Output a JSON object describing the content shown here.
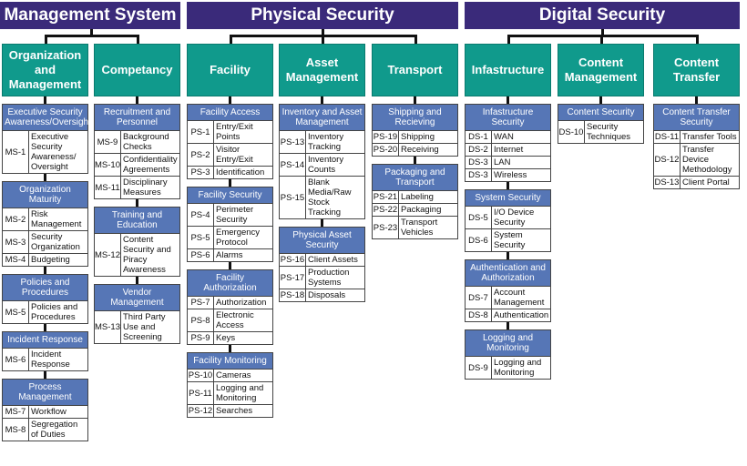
{
  "sections": [
    {
      "title": "Management System",
      "columns": [
        0,
        1
      ]
    },
    {
      "title": "Physical Security",
      "columns": [
        2,
        3,
        4
      ]
    },
    {
      "title": "Digital Security",
      "columns": [
        5,
        6,
        7
      ]
    }
  ],
  "columns": [
    {
      "title": "Organization and Management",
      "groups": [
        {
          "title": "Executive Security Awareness/Oversight",
          "items": [
            [
              "MS-1",
              "Executive Security Awareness/ Oversight"
            ]
          ]
        },
        {
          "title": "Organization Maturity",
          "items": [
            [
              "MS-2",
              "Risk Management"
            ],
            [
              "MS-3",
              "Security Organization"
            ],
            [
              "MS-4",
              "Budgeting"
            ]
          ]
        },
        {
          "title": "Policies and Procedures",
          "items": [
            [
              "MS-5",
              "Policies and Procedures"
            ]
          ]
        },
        {
          "title": "Incident Response",
          "items": [
            [
              "MS-6",
              "Incident Response"
            ]
          ]
        },
        {
          "title": "Process Management",
          "items": [
            [
              "MS-7",
              "Workflow"
            ],
            [
              "MS-8",
              "Segregation of Duties"
            ]
          ]
        }
      ]
    },
    {
      "title": "Competancy",
      "groups": [
        {
          "title": "Recruitment and Personnel",
          "items": [
            [
              "MS-9",
              "Background Checks"
            ],
            [
              "MS-10",
              "Confidentiality Agreements"
            ],
            [
              "MS-11",
              "Disciplinary Measures"
            ]
          ]
        },
        {
          "title": "Training and Education",
          "items": [
            [
              "MS-12",
              "Content Security and Piracy Awareness"
            ]
          ]
        },
        {
          "title": "Vendor Management",
          "items": [
            [
              "MS-13",
              "Third Party Use and Screening"
            ]
          ]
        }
      ]
    },
    {
      "title": "Facility",
      "groups": [
        {
          "title": "Facility Access",
          "items": [
            [
              "PS-1",
              "Entry/Exit Points"
            ],
            [
              "PS-2",
              "Visitor Entry/Exit"
            ],
            [
              "PS-3",
              "Identification"
            ]
          ]
        },
        {
          "title": "Facility Security",
          "items": [
            [
              "PS-4",
              "Perimeter Security"
            ],
            [
              "PS-5",
              "Emergency Protocol"
            ],
            [
              "PS-6",
              "Alarms"
            ]
          ]
        },
        {
          "title": "Facility Authorization",
          "items": [
            [
              "PS-7",
              "Authorization"
            ],
            [
              "PS-8",
              "Electronic Access"
            ],
            [
              "PS-9",
              "Keys"
            ]
          ]
        },
        {
          "title": "Facility Monitoring",
          "items": [
            [
              "PS-10",
              "Cameras"
            ],
            [
              "PS-11",
              "Logging and Monitoring"
            ],
            [
              "PS-12",
              "Searches"
            ]
          ]
        }
      ]
    },
    {
      "title": "Asset Management",
      "groups": [
        {
          "title": "Inventory and Asset Management",
          "items": [
            [
              "PS-13",
              "Inventory Tracking"
            ],
            [
              "PS-14",
              "Inventory Counts"
            ],
            [
              "PS-15",
              "Blank Media/Raw Stock Tracking"
            ]
          ]
        },
        {
          "title": "Physical Asset Security",
          "items": [
            [
              "PS-16",
              "Client Assets"
            ],
            [
              "PS-17",
              "Production Systems"
            ],
            [
              "PS-18",
              "Disposals"
            ]
          ]
        }
      ]
    },
    {
      "title": "Transport",
      "groups": [
        {
          "title": "Shipping and Recieving",
          "items": [
            [
              "PS-19",
              "Shipping"
            ],
            [
              "PS-20",
              "Receiving"
            ]
          ]
        },
        {
          "title": "Packaging and Transport",
          "items": [
            [
              "PS-21",
              "Labeling"
            ],
            [
              "PS-22",
              "Packaging"
            ],
            [
              "PS-23",
              "Transport Vehicles"
            ]
          ]
        }
      ]
    },
    {
      "title": "Infastructure",
      "groups": [
        {
          "title": "Infastructure Security",
          "items": [
            [
              "DS-1",
              "WAN"
            ],
            [
              "DS-2",
              "Internet"
            ],
            [
              "DS-3",
              "LAN"
            ],
            [
              "DS-3",
              "Wireless"
            ]
          ]
        },
        {
          "title": "System Security",
          "items": [
            [
              "DS-5",
              "I/O Device Security"
            ],
            [
              "DS-6",
              "System Security"
            ]
          ]
        },
        {
          "title": "Authentication and Authorization",
          "items": [
            [
              "DS-7",
              "Account Management"
            ],
            [
              "DS-8",
              "Authentication"
            ]
          ]
        },
        {
          "title": "Logging and Monitoring",
          "items": [
            [
              "DS-9",
              "Logging and Monitoring"
            ]
          ]
        }
      ]
    },
    {
      "title": "Content Management",
      "groups": [
        {
          "title": "Content Security",
          "items": [
            [
              "DS-10",
              "Security Techniques"
            ]
          ]
        }
      ]
    },
    {
      "title": "Content Transfer",
      "groups": [
        {
          "title": "Content Transfer Security",
          "items": [
            [
              "DS-11",
              "Transfer Tools"
            ],
            [
              "DS-12",
              "Transfer Device Methodology"
            ],
            [
              "DS-13",
              "Client Portal"
            ]
          ]
        }
      ]
    }
  ]
}
